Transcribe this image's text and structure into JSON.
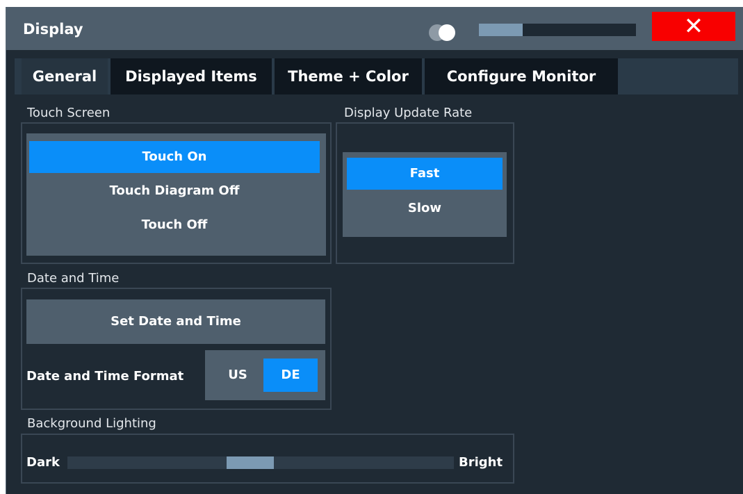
{
  "window": {
    "title": "Display",
    "close_glyph": "✕",
    "transparency_level": 0.28
  },
  "tabs": [
    {
      "label": "General",
      "active": true
    },
    {
      "label": "Displayed Items",
      "active": false
    },
    {
      "label": "Theme + Color",
      "active": false
    },
    {
      "label": "Configure Monitor",
      "active": false
    }
  ],
  "touch_screen": {
    "heading": "Touch Screen",
    "options": [
      "Touch On",
      "Touch Diagram Off",
      "Touch Off"
    ],
    "selected": "Touch On"
  },
  "update_rate": {
    "heading": "Display Update Rate",
    "options": [
      "Fast",
      "Slow"
    ],
    "selected": "Fast"
  },
  "date_time": {
    "heading": "Date and Time",
    "set_button": "Set Date and Time",
    "format_label": "Date and Time Format",
    "format_options": [
      "US",
      "DE"
    ],
    "format_selected": "DE"
  },
  "background_lighting": {
    "heading": "Background Lighting",
    "min_label": "Dark",
    "max_label": "Bright",
    "level": 0.47
  },
  "colors": {
    "accent": "#0a8ef9",
    "close": "#f80000",
    "panel": "#4f5f6d",
    "background": "#1f2a34"
  }
}
